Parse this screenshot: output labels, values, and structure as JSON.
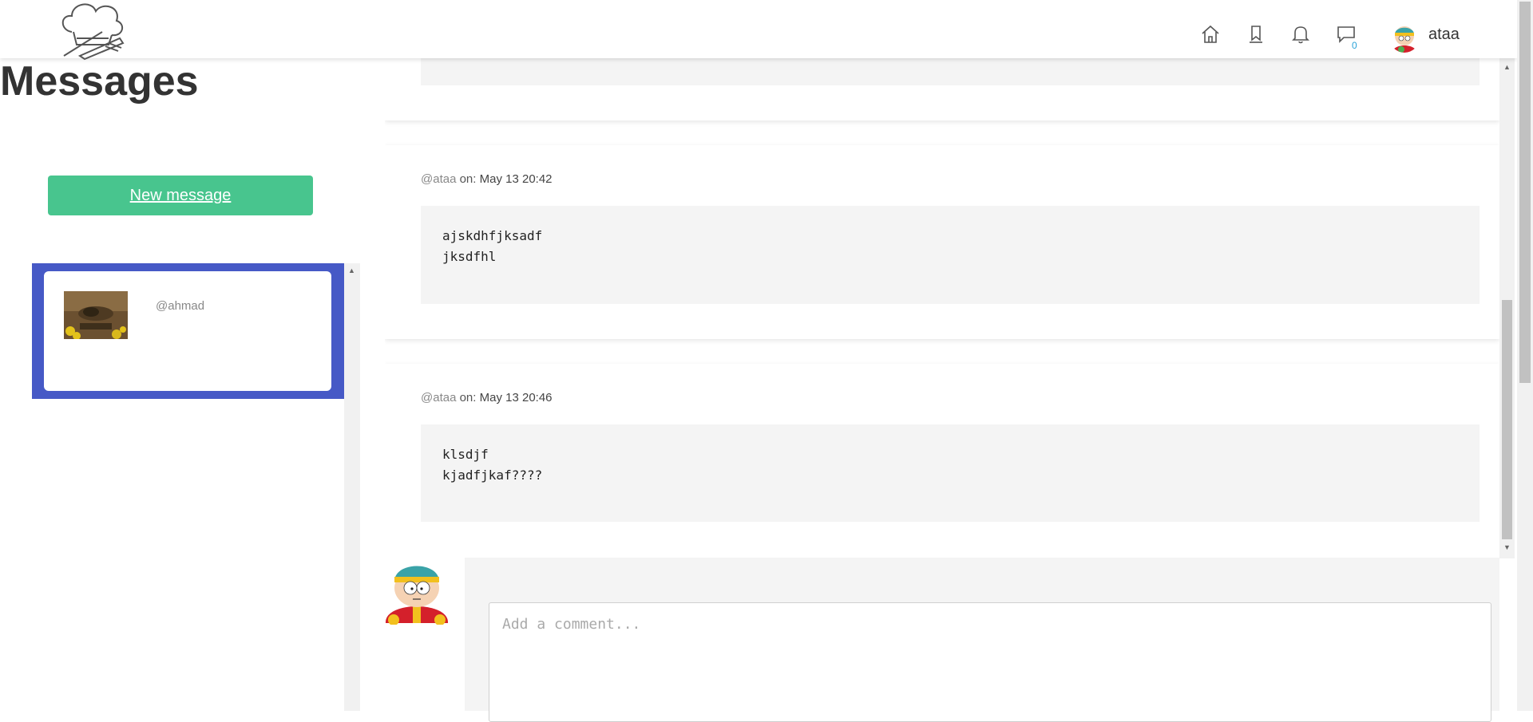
{
  "header": {
    "icons": [
      "chef-logo-icon",
      "home-icon",
      "bookmark-icon",
      "bell-icon",
      "chat-icon"
    ],
    "messages_count": "0",
    "username": "ataa"
  },
  "sidebar": {
    "title": "Messages",
    "new_message_label": "New message",
    "conversations": [
      {
        "username": "@ahmad",
        "selected": true
      }
    ]
  },
  "messages": [
    {
      "author": "@ataa",
      "on_label": "on:",
      "date": "May 13 20:42",
      "text": "ajskdhfjksadf\njksdfhl"
    },
    {
      "author": "@ataa",
      "on_label": "on:",
      "date": "May 13 20:46",
      "text": "klsdjf\nkjadfjkaf????"
    }
  ],
  "comment": {
    "placeholder": "Add a comment..."
  },
  "colors": {
    "accent_green": "#48c58e",
    "selected_blue": "#4659c6",
    "badge_blue": "#2aa3d8"
  }
}
